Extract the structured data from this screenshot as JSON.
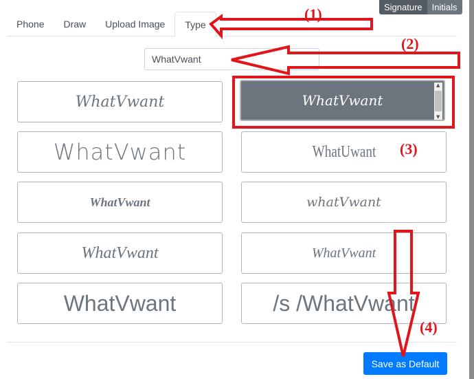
{
  "mode_toggle": {
    "signature": "Signature",
    "initials": "Initials"
  },
  "tabs": [
    {
      "label": "Phone"
    },
    {
      "label": "Draw"
    },
    {
      "label": "Upload Image"
    },
    {
      "label": "Type",
      "active": true
    }
  ],
  "name_input": {
    "value": "WhatVwant"
  },
  "signature_options": [
    "WhatVwant",
    "WhatVwant",
    "WhatVwant",
    "WhatUwant",
    "WhatVwant",
    "whatVwant",
    "WhatVwant",
    "WhatVwant",
    "WhatVwant",
    "/s /WhatVwant"
  ],
  "selected_option_index": 1,
  "save_button": "Save as Default",
  "annotations": {
    "label1": "(1)",
    "label2": "(2)",
    "label3": "(3)",
    "label4": "(4)",
    "color": "#e0161d"
  },
  "colors": {
    "primary": "#007bff",
    "selected": "#6c757d"
  }
}
